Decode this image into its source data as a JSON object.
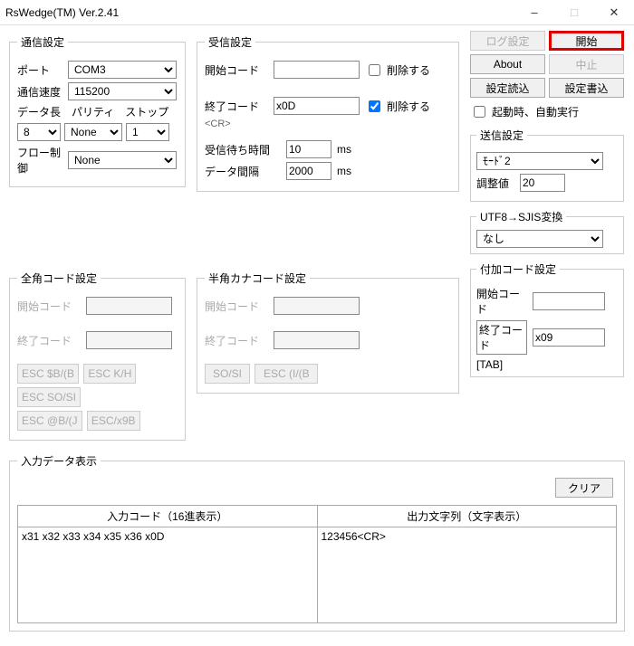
{
  "title": "RsWedge(TM) Ver.2.41",
  "comm": {
    "legend": "通信設定",
    "port_label": "ポート",
    "port_value": "COM3",
    "baud_label": "通信速度",
    "baud_value": "115200",
    "data_label": "データ長",
    "parity_label": "パリティ",
    "stop_label": "ストップ",
    "data_value": "8",
    "parity_value": "None",
    "stop_value": "1",
    "flow_label": "フロー制御",
    "flow_value": "None"
  },
  "recv": {
    "legend": "受信設定",
    "start_label": "開始コード",
    "start_value": "",
    "start_del": "削除する",
    "end_label": "終了コード",
    "end_value": "x0D",
    "end_del": "削除する",
    "cr_note": "<CR>",
    "wait_label": "受信待ち時間",
    "wait_value": "10",
    "ms1": "ms",
    "gap_label": "データ間隔",
    "gap_value": "2000",
    "ms2": "ms"
  },
  "side": {
    "log": "ログ設定",
    "start": "開始",
    "about": "About",
    "stop": "中止",
    "read": "設定読込",
    "write": "設定書込",
    "autorun": "起動時、自動実行"
  },
  "send": {
    "legend": "送信設定",
    "mode_value": "ﾓｰﾄﾞ2",
    "adj_label": "調整値",
    "adj_value": "20"
  },
  "conv": {
    "legend": "UTF8→SJIS変換",
    "value": "なし"
  },
  "zen": {
    "legend": "全角コード設定",
    "start_label": "開始コード",
    "end_label": "終了コード",
    "b1": "ESC $B/(B",
    "b2": "ESC K/H",
    "b3": "ESC SO/SI",
    "b4": "ESC @B/(J",
    "b5": "ESC/x9B"
  },
  "han": {
    "legend": "半角カナコード設定",
    "start_label": "開始コード",
    "end_label": "終了コード",
    "b1": "SO/SI",
    "b2": "ESC (I/(B"
  },
  "add": {
    "legend": "付加コード設定",
    "start_label": "開始コード",
    "start_value": "",
    "end_label": "終了コード",
    "end_value": "x09",
    "tab_note": "[TAB]"
  },
  "io": {
    "legend": "入力データ表示",
    "clear": "クリア",
    "head_in": "入力コード（16進表示）",
    "head_out": "出力文字列（文字表示）",
    "in_text": "x31 x32 x33 x34 x35 x36 x0D",
    "out_text": "123456<CR>"
  }
}
